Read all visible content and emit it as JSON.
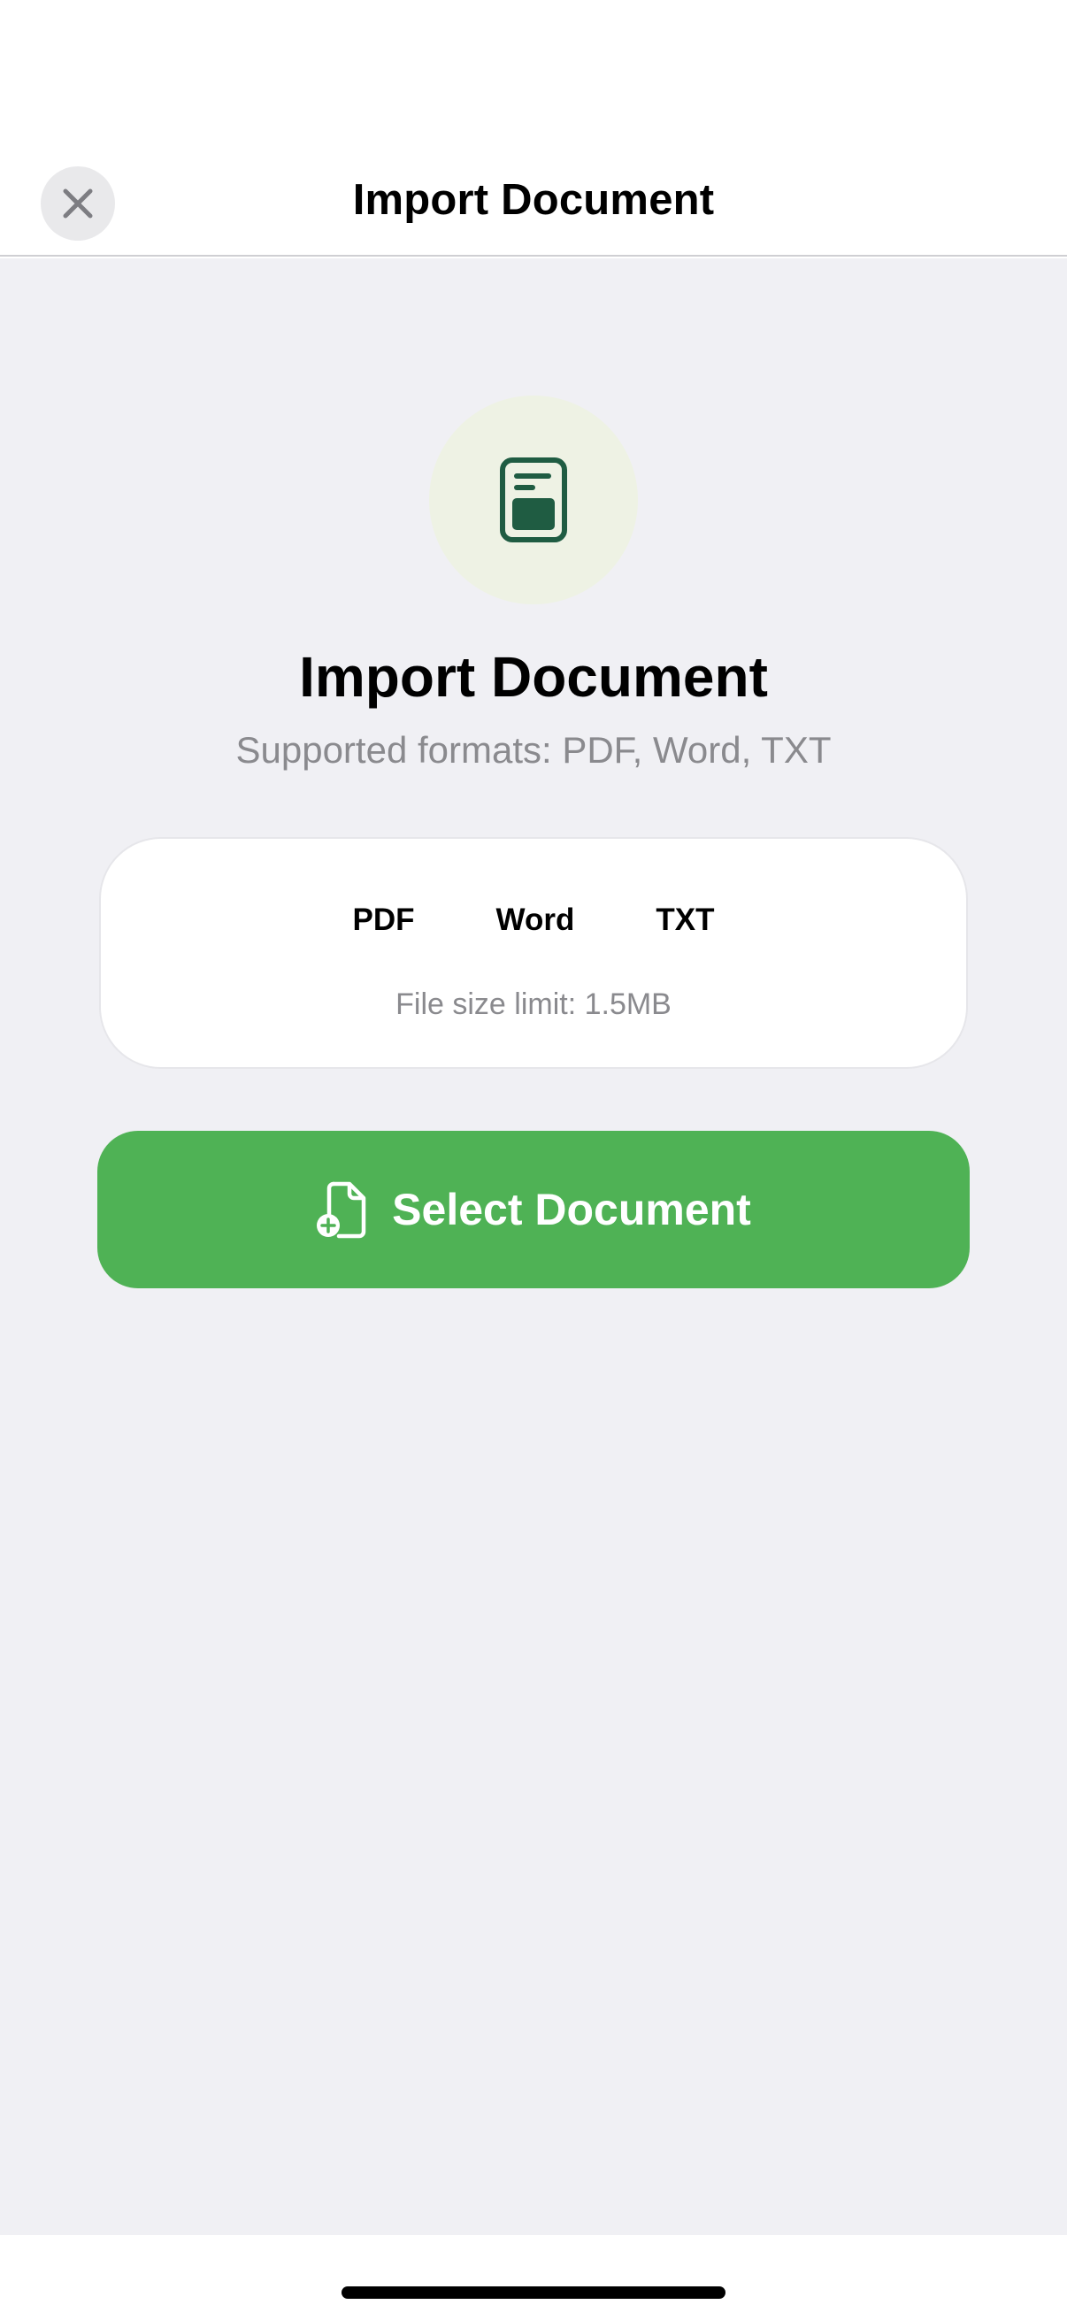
{
  "nav": {
    "title": "Import Document",
    "close_icon": "close-icon"
  },
  "hero": {
    "icon": "document-icon",
    "icon_color": "#1f5c42",
    "circle_color": "#eef2e4",
    "title": "Import Document",
    "subtitle": "Supported formats: PDF, Word, TXT"
  },
  "formats_card": {
    "formats": [
      "PDF",
      "Word",
      "TXT"
    ],
    "size_limit": "File size limit: 1.5MB"
  },
  "select_button": {
    "label": "Select Document",
    "icon": "document-add-icon",
    "color": "#4fb255"
  }
}
